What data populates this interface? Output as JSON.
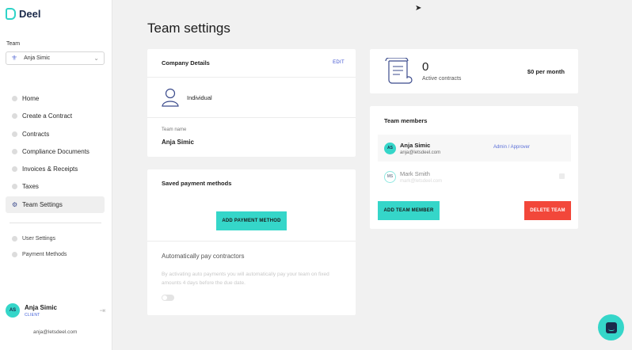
{
  "brand": {
    "name": "Deel",
    "accent": "#35d6c9",
    "danger": "#f2473a"
  },
  "sidebar": {
    "team_label": "Team",
    "team_select": "Anja Simic",
    "nav": [
      {
        "label": "Home",
        "icon": "home-icon"
      },
      {
        "label": "Create a Contract",
        "icon": "plus-icon"
      },
      {
        "label": "Contracts",
        "icon": "document-icon"
      },
      {
        "label": "Compliance Documents",
        "icon": "pen-icon"
      },
      {
        "label": "Invoices & Receipts",
        "icon": "invoice-icon"
      },
      {
        "label": "Taxes",
        "icon": "taxes-icon"
      },
      {
        "label": "Team Settings",
        "icon": "gear-icon"
      }
    ],
    "nav2": [
      {
        "label": "User Settings",
        "icon": "user-icon"
      },
      {
        "label": "Payment Methods",
        "icon": "card-icon"
      }
    ],
    "user": {
      "initials": "AS",
      "name": "Anja Simic",
      "role": "CLIENT",
      "email": "anja@letsdeel.com"
    }
  },
  "main": {
    "title": "Team settings",
    "company": {
      "heading": "Company Details",
      "edit": "EDIT",
      "type": "Individual",
      "team_name_label": "Team name",
      "team_name": "Anja Simic"
    },
    "payment": {
      "heading": "Saved payment methods",
      "add_button": "ADD PAYMENT METHOD",
      "auto_pay_label": "Automatically pay contractors",
      "auto_pay_desc": "By activating auto payments you will automatically pay your team on fixed amounts 4 days before the due date."
    },
    "contracts": {
      "count": "0",
      "label": "Active contracts",
      "amount": "$0 per month"
    },
    "members": {
      "heading": "Team members",
      "list": [
        {
          "initials": "AS",
          "name": "Anja Simic",
          "email": "anja@letsdeel.com",
          "role": "Admin / Approver"
        },
        {
          "initials": "MS",
          "name": "Mark Smith",
          "email": "mark@letsdeel.com",
          "role": ""
        }
      ],
      "add_button": "ADD TEAM MEMBER",
      "delete_button": "DELETE TEAM"
    }
  }
}
